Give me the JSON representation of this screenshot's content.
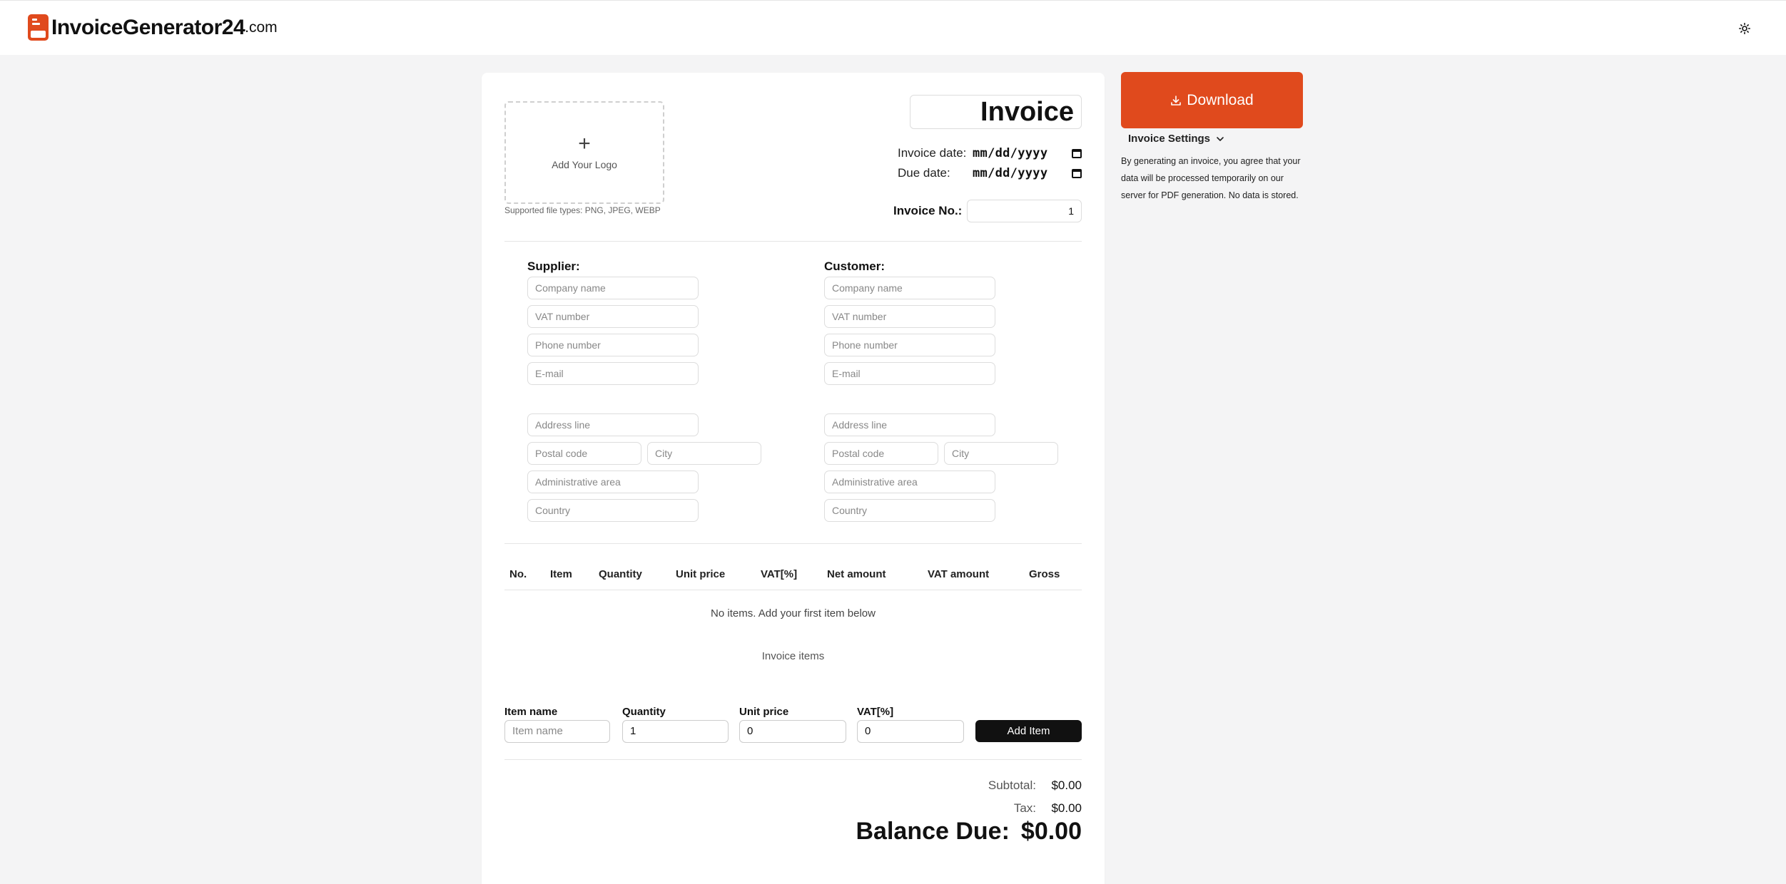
{
  "brand": {
    "name": "InvoiceGenerator24",
    "tld": ".com",
    "accent": "#e04a1d"
  },
  "header": {
    "theme_icon": "sun-icon"
  },
  "invoice": {
    "title": "Invoice",
    "logo_label": "Add Your Logo",
    "file_types": "Supported file types: PNG, JPEG, WEBP",
    "invoice_date_label": "Invoice date:",
    "invoice_date_value": "mm/dd/yyyy",
    "due_date_label": "Due date:",
    "due_date_value": "mm/dd/yyyy",
    "number_label": "Invoice No.:",
    "number_value": "1"
  },
  "supplier": {
    "title": "Supplier:",
    "company": "Company name",
    "vat": "VAT number",
    "phone": "Phone number",
    "email": "E-mail",
    "address": "Address line",
    "postal": "Postal code",
    "city": "City",
    "area": "Administrative area",
    "country": "Country"
  },
  "customer": {
    "title": "Customer:",
    "company": "Company name",
    "vat": "VAT number",
    "phone": "Phone number",
    "email": "E-mail",
    "address": "Address line",
    "postal": "Postal code",
    "city": "City",
    "area": "Administrative area",
    "country": "Country"
  },
  "table": {
    "headers": [
      "No.",
      "Item",
      "Quantity",
      "Unit price",
      "VAT[%]",
      "Net amount",
      "VAT amount",
      "Gross"
    ],
    "empty_message": "No items. Add your first item below",
    "caption": "Invoice items"
  },
  "new_item": {
    "name_label": "Item name",
    "name_placeholder": "Item name",
    "quantity_label": "Quantity",
    "quantity_value": "1",
    "unit_price_label": "Unit price",
    "unit_price_value": "0",
    "vat_label": "VAT[%]",
    "vat_value": "0",
    "add_button": "Add Item"
  },
  "totals": {
    "subtotal_label": "Subtotal:",
    "subtotal_value": "$0.00",
    "tax_label": "Tax:",
    "tax_value": "$0.00",
    "balance_label": "Balance Due:",
    "balance_value": "$0.00"
  },
  "sidebar": {
    "download_label": "Download",
    "settings_label": "Invoice Settings",
    "disclaimer": "By generating an invoice, you agree that your data will be processed temporarily on our server for PDF generation. No data is stored."
  }
}
